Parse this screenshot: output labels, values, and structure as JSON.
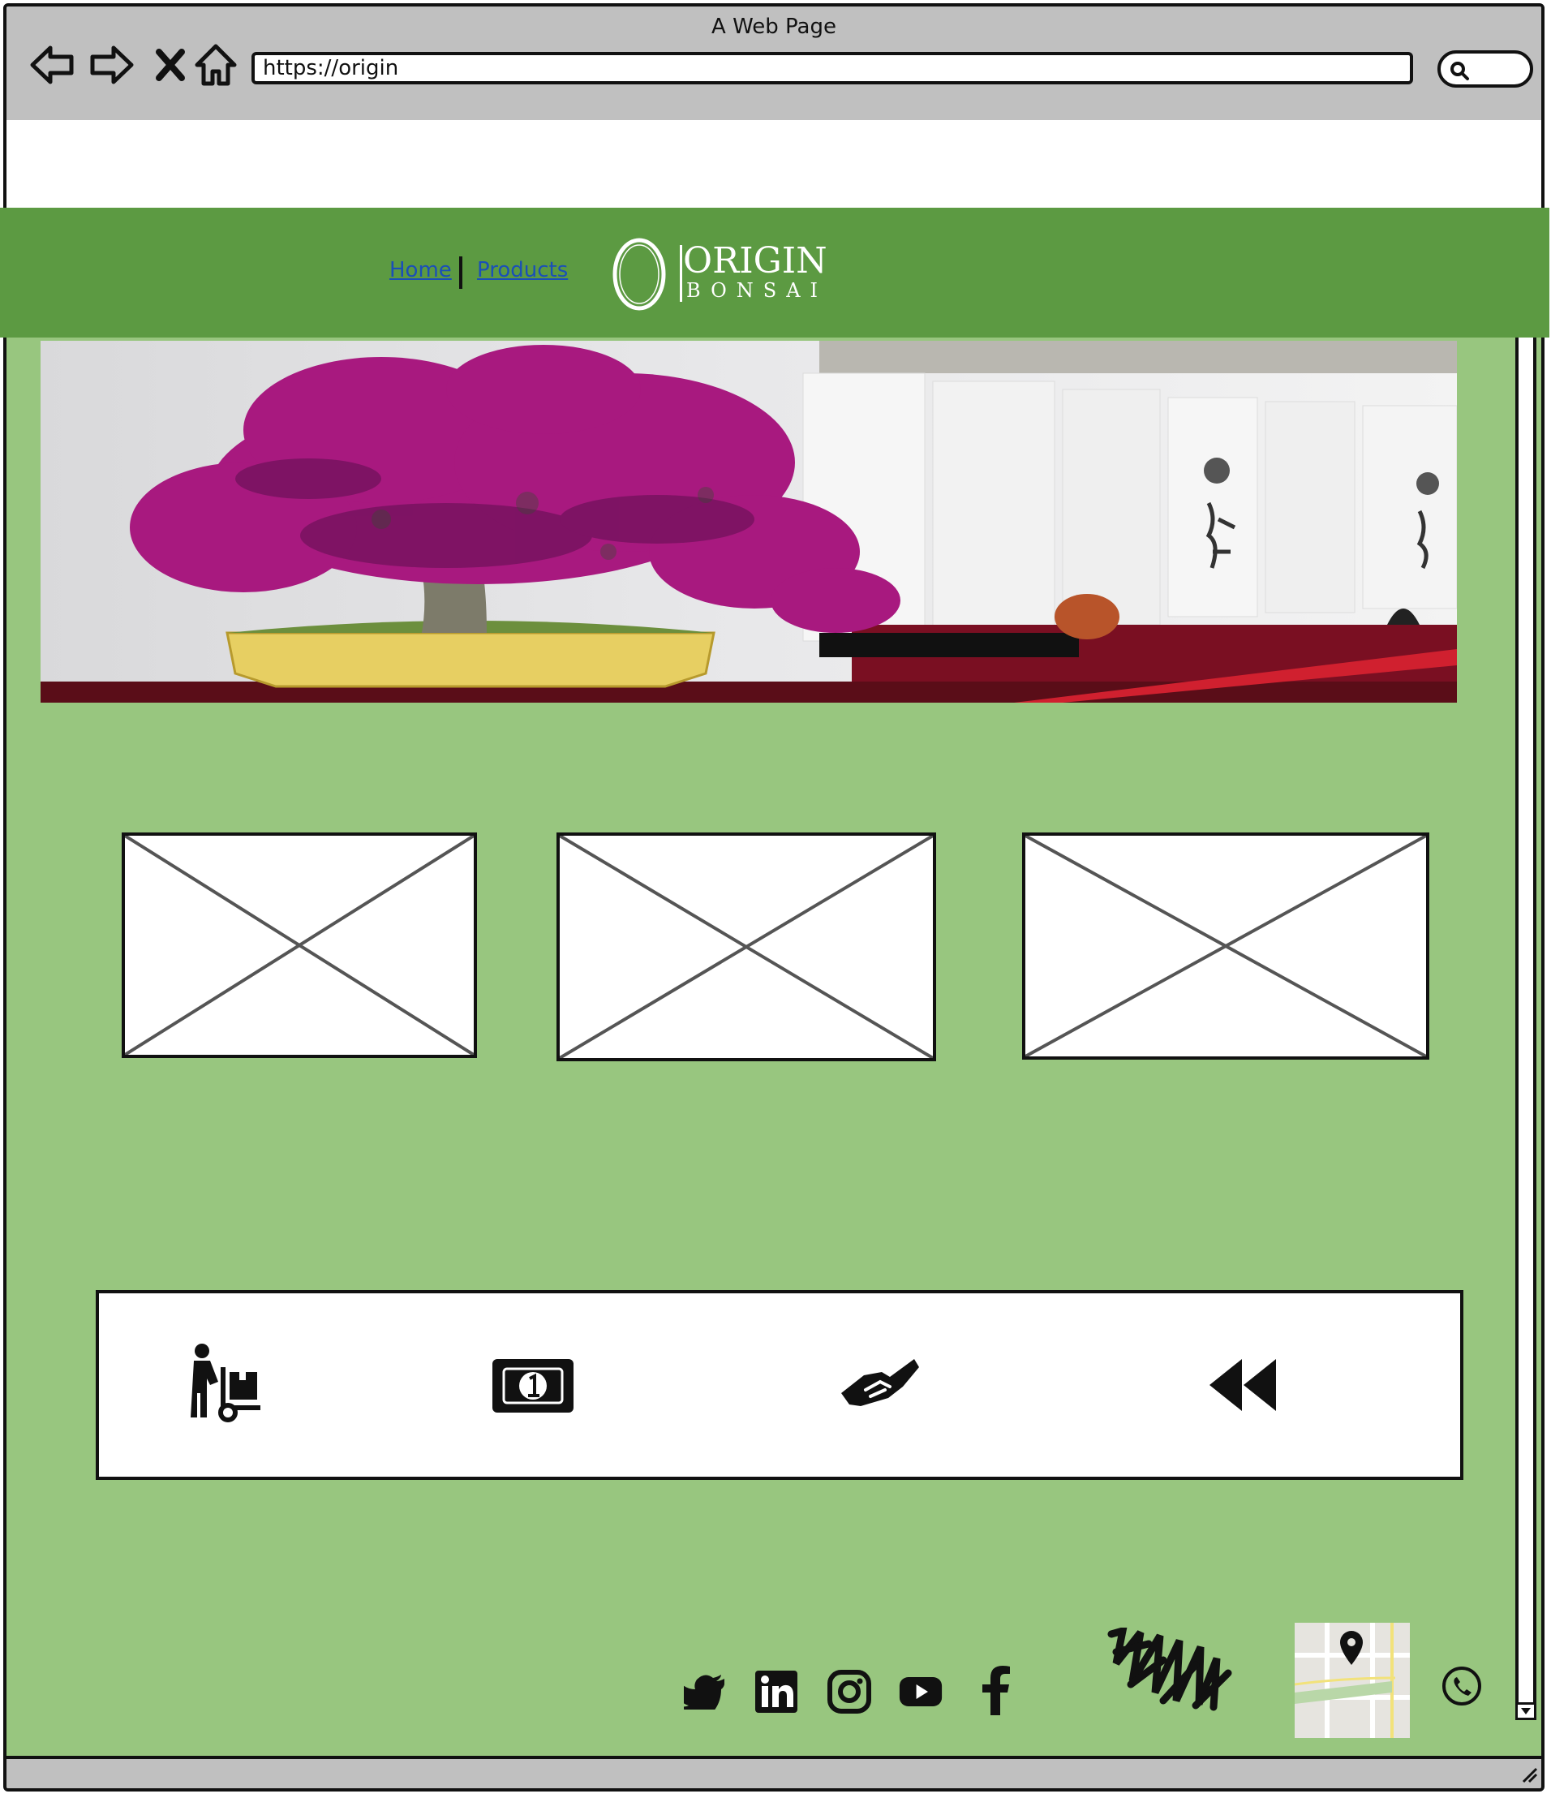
{
  "browser": {
    "window_title": "A Web Page",
    "url": "https://origin"
  },
  "nav": {
    "home_label": "Home",
    "products_label": "Products"
  },
  "logo": {
    "word": "ORIGIN",
    "sub": "BONSAI"
  },
  "hero": {
    "image": "bonsai-bougainvillea-photo"
  },
  "placeholders": [
    "image-placeholder",
    "image-placeholder",
    "image-placeholder"
  ],
  "features": [
    "delivery-icon",
    "money-icon",
    "handshake-icon",
    "rewind-icon"
  ],
  "footer": {
    "social_icons": [
      "twitter-icon",
      "linkedin-icon",
      "instagram-icon",
      "youtube-icon",
      "facebook-icon"
    ],
    "scribble": "scribble-logo",
    "map": "map-thumbnail",
    "phone": "phone-icon"
  },
  "colors": {
    "page_bg": "#98c67f",
    "header_bg": "#5c9a42",
    "browser_chrome": "#c0c0c0",
    "link": "#1a4fb8"
  }
}
